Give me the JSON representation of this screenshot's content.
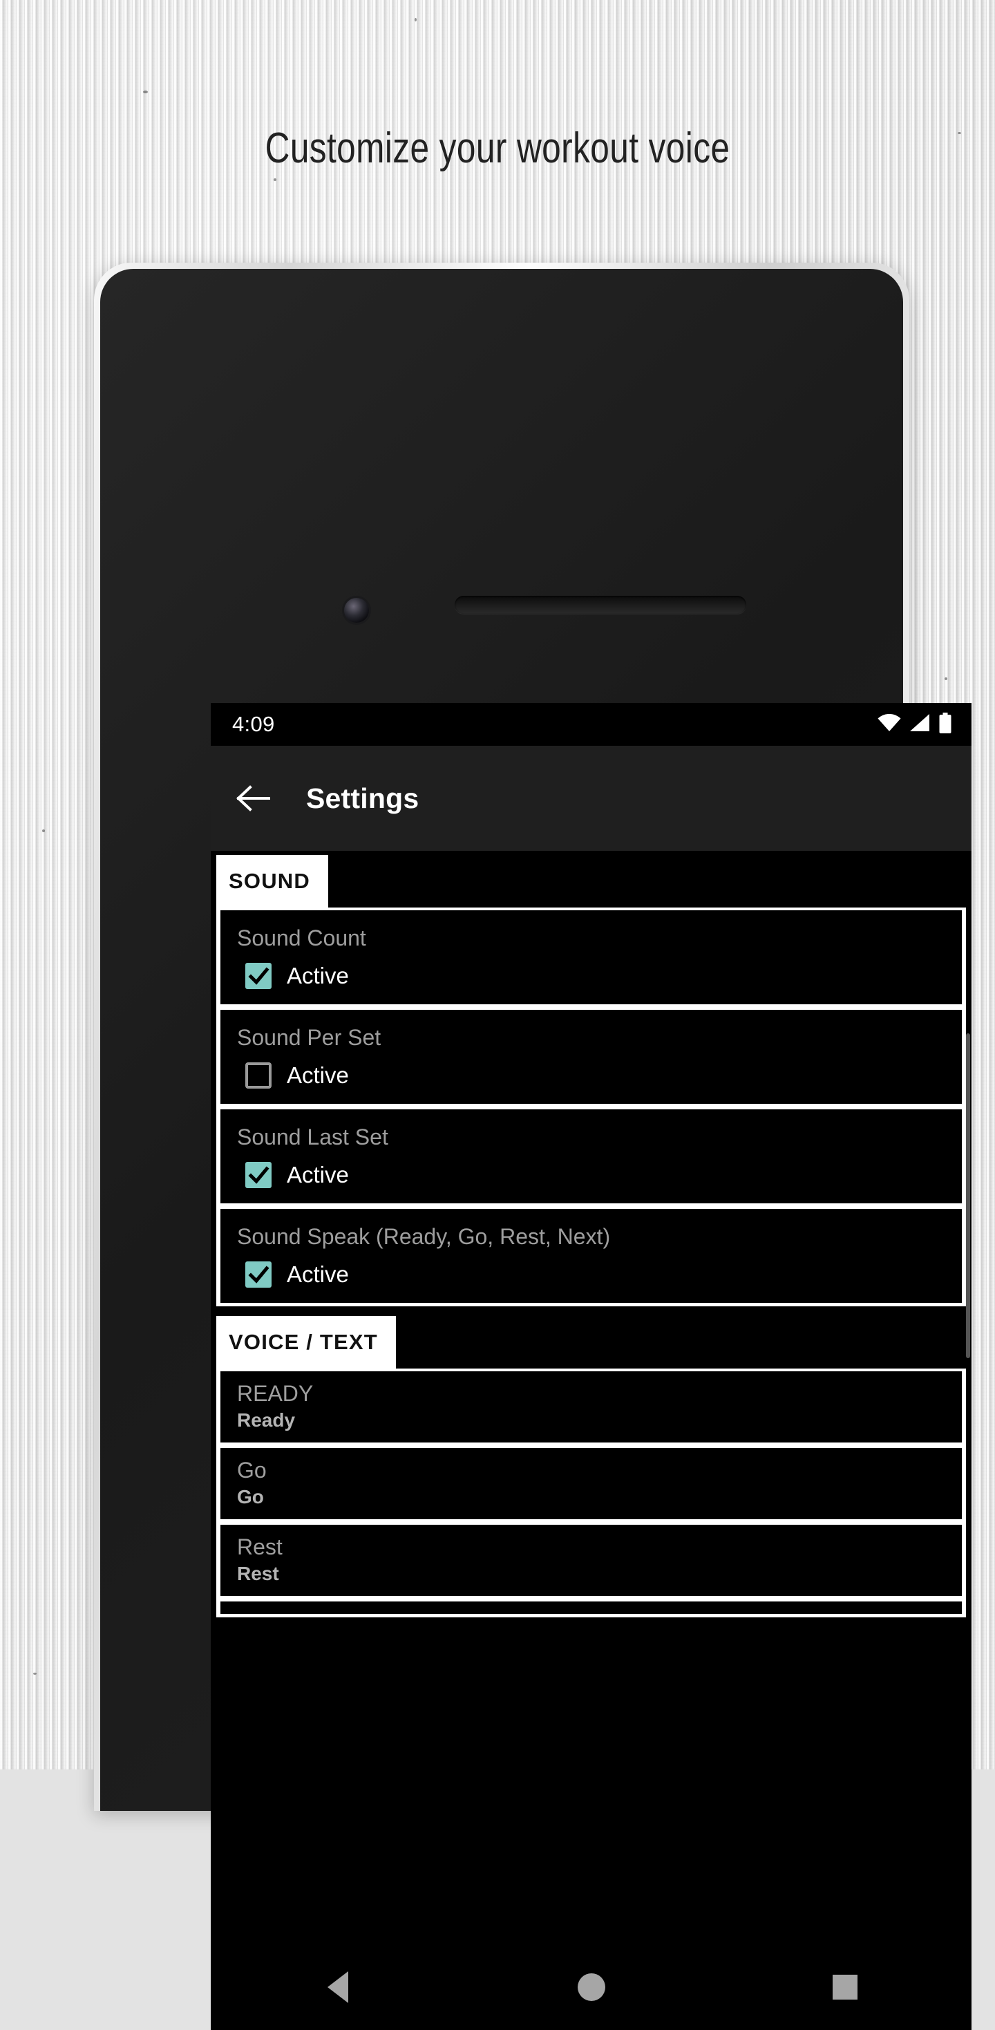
{
  "headline": "Customize your workout voice",
  "colors": {
    "accent_checkbox": "#80cbc4",
    "app_background": "#000000",
    "appbar": "#1f1f1f",
    "chip_background": "#ffffff",
    "title_text": "#222222"
  },
  "phone": {
    "status_bar": {
      "time": "4:09",
      "icons": [
        "wifi-icon",
        "signal-icon",
        "battery-icon"
      ]
    },
    "app_bar": {
      "back_icon": "back-arrow-icon",
      "title": "Settings"
    },
    "nav_bar": {
      "back": "nav-back-icon",
      "home": "nav-home-icon",
      "recents": "nav-recents-icon"
    }
  },
  "sections": [
    {
      "chip_label": "SOUND",
      "type": "checkboxes",
      "items": [
        {
          "title": "Sound Count",
          "checkbox_label": "Active",
          "checked": true
        },
        {
          "title": "Sound Per Set",
          "checkbox_label": "Active",
          "checked": false
        },
        {
          "title": "Sound Last Set",
          "checkbox_label": "Active",
          "checked": true
        },
        {
          "title": "Sound Speak (Ready, Go, Rest, Next)",
          "checkbox_label": "Active",
          "checked": true
        }
      ]
    },
    {
      "chip_label": "VOICE / TEXT",
      "type": "key-value",
      "items": [
        {
          "key": "READY",
          "value": "Ready"
        },
        {
          "key": "Go",
          "value": "Go"
        },
        {
          "key": "Rest",
          "value": "Rest"
        }
      ]
    }
  ]
}
